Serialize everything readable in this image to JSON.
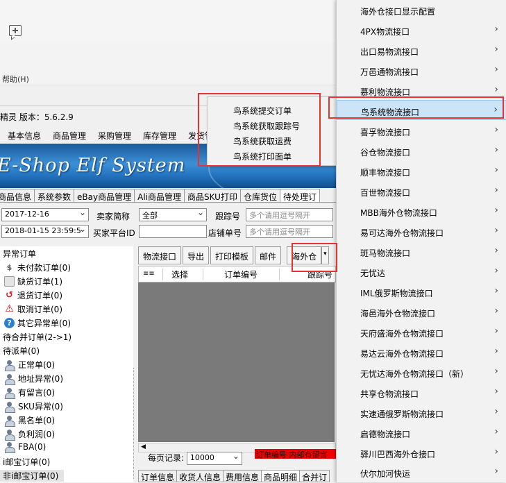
{
  "window": {
    "help_menu": "帮助(H)",
    "app_title": "精灵  版本：5.6.2.9"
  },
  "menubar": [
    "基本信息",
    "商品管理",
    "采购管理",
    "库存管理",
    "发货管"
  ],
  "banner": {
    "logo_text": "E-Shop Elf System"
  },
  "main_tabs": [
    {
      "label": "商品信息",
      "active": false
    },
    {
      "label": "系统参数",
      "active": false
    },
    {
      "label": "eBay商品管理",
      "active": false
    },
    {
      "label": "Ali商品管理",
      "active": false
    },
    {
      "label": "商品SKU打印",
      "active": false
    },
    {
      "label": "仓库货位",
      "active": false
    },
    {
      "label": "待处理订",
      "active": true
    }
  ],
  "filters": {
    "date_from": "2017-12-16",
    "date_to": "2018-01-15 23:59:5",
    "seller_label": "卖家简称",
    "seller_value": "全部",
    "buyer_platform_id_label": "买家平台ID",
    "buyer_platform_id_value": "",
    "tracking_label": "跟踪号",
    "tracking_placeholder": "多个请用逗号隔开",
    "shop_order_label": "店铺单号",
    "shop_order_placeholder": "多个请用逗号隔开"
  },
  "tree": {
    "root_abnormal": "异常订单",
    "items_abnormal": [
      {
        "label": "未付款订单(0)",
        "icon": "dollar-icon"
      },
      {
        "label": "缺货订单(1)",
        "icon": "box-icon"
      },
      {
        "label": "退货订单(0)",
        "icon": "return-icon"
      },
      {
        "label": "取消订单(0)",
        "icon": "warning-icon"
      },
      {
        "label": "其它异常单(0)",
        "icon": "help-icon"
      }
    ],
    "merge": "待合并订单(2->1)",
    "dispatch": "待派单(0)",
    "items_dispatch": [
      {
        "label": "正常单(0)"
      },
      {
        "label": "地址异常(0)"
      },
      {
        "label": "有留言(0)"
      },
      {
        "label": "SKU异常(0)"
      },
      {
        "label": "黑名单(0)"
      },
      {
        "label": "负利润(0)"
      },
      {
        "label": "FBA(0)"
      }
    ],
    "taobao": "i邮宝订单(0)",
    "non_taobao": "非i邮宝订单(0)"
  },
  "toolbar": {
    "logistics": "物流接口",
    "export": "导出",
    "print_template": "打印模板",
    "mail": "邮件",
    "overseas": "海外仓"
  },
  "grid": {
    "columns": [
      "选择",
      "订单编号",
      "跟踪号"
    ]
  },
  "paging": {
    "label": "每页记录:",
    "value": "10000"
  },
  "red_notice": "订单编号  内部有留言",
  "bottom_tabs": [
    {
      "label": "订单信息",
      "active": false
    },
    {
      "label": "收货人信息",
      "active": false
    },
    {
      "label": "费用信息",
      "active": false
    },
    {
      "label": "商品明细",
      "active": true
    },
    {
      "label": "合并订",
      "active": false
    }
  ],
  "submenu": [
    "鸟系统提交订单",
    "鸟系统获取跟踪号",
    "鸟系统获取运费",
    "鸟系统打印面单"
  ],
  "overseas_menu": [
    {
      "label": "海外仓接口显示配置",
      "arrow": false
    },
    {
      "label": "4PX物流接口",
      "arrow": true
    },
    {
      "label": "出口易物流接口",
      "arrow": true
    },
    {
      "label": "万邑通物流接口",
      "arrow": true
    },
    {
      "label": "慕利物流接口",
      "arrow": true
    },
    {
      "label": "鸟系统物流接口",
      "arrow": true,
      "selected": true
    },
    {
      "label": "喜孚物流接口",
      "arrow": true
    },
    {
      "label": "谷仓物流接口",
      "arrow": true
    },
    {
      "label": "顺丰物流接口",
      "arrow": true
    },
    {
      "label": "百世物流接口",
      "arrow": true
    },
    {
      "label": "MBB海外仓物流接口",
      "arrow": true
    },
    {
      "label": "易可达海外仓物流接口",
      "arrow": true
    },
    {
      "label": "斑马物流接口",
      "arrow": true
    },
    {
      "label": "无忧达",
      "arrow": true
    },
    {
      "label": "IML俄罗斯物流接口",
      "arrow": true
    },
    {
      "label": "海邑海外仓物流接口",
      "arrow": true
    },
    {
      "label": "天府盛海外仓物流接口",
      "arrow": true
    },
    {
      "label": "易达云海外仓物流接口",
      "arrow": true
    },
    {
      "label": "无忧达海外仓物流接口（新）",
      "arrow": true
    },
    {
      "label": "共享仓物流接口",
      "arrow": true
    },
    {
      "label": "实速通俄罗斯物流接口",
      "arrow": true
    },
    {
      "label": "启德物流接口",
      "arrow": true
    },
    {
      "label": "驿川巴西海外仓接口",
      "arrow": true
    },
    {
      "label": "伏尔加河快运",
      "arrow": true
    }
  ],
  "colors": {
    "highlight": "#cce4f7",
    "annotation_red": "#e8322e",
    "banner_blue": "#2576c2"
  }
}
